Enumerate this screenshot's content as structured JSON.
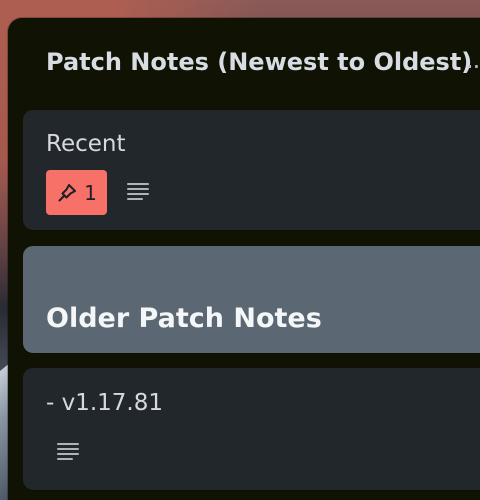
{
  "list": {
    "title": "Patch Notes (Newest to Oldest)",
    "more_icon": "more-horizontal-icon"
  },
  "cards": [
    {
      "title": "Recent",
      "badge_count": "1",
      "badge_icon": "pin-icon",
      "description_icon": "description-icon"
    },
    {
      "title": "Older Patch Notes"
    },
    {
      "title": "- v1.17.81",
      "description_icon": "description-icon"
    }
  ],
  "colors": {
    "list_background": "#101204",
    "card_background": "#22272b",
    "cover_card_background": "#5b6873",
    "badge_background": "#f87168",
    "text_primary": "#d6dadf"
  }
}
